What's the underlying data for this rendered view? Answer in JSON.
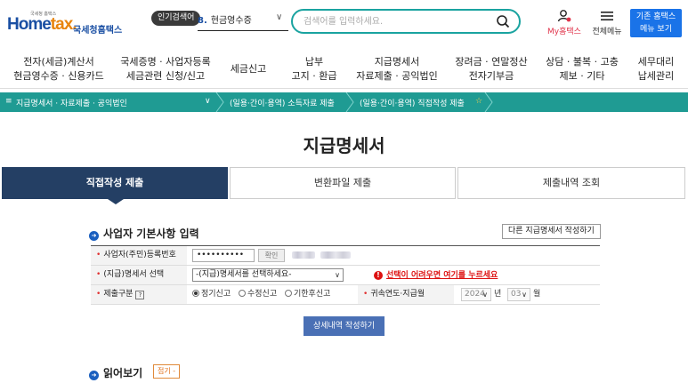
{
  "header": {
    "logo_tagline": "국세청 홈택스",
    "logo_home": "Home",
    "logo_tax": "tax.",
    "logo_text": "국세청홈택스",
    "popular_badge": "인기검색어",
    "popular_rank": "8.",
    "popular_term": "현금영수증",
    "search_placeholder": "검색어를 입력하세요.",
    "my_hometax": "My홈택스",
    "all_menu": "전체메뉴",
    "old_menu_line1": "기존 홈택스",
    "old_menu_line2": "메뉴 보기"
  },
  "nav": [
    {
      "l1": "전자(세금)계산서",
      "l2": "현금영수증 · 신용카드"
    },
    {
      "l1": "국세증명 · 사업자등록",
      "l2": "세금관련 신청/신고"
    },
    {
      "l1": "세금신고",
      "l2": ""
    },
    {
      "l1": "납부",
      "l2": "고지 · 환급"
    },
    {
      "l1": "지급명세서",
      "l2": "자료제출 · 공익법인"
    },
    {
      "l1": "장려금 · 연말정산",
      "l2": "전자기부금"
    },
    {
      "l1": "상담 · 불복 · 고충",
      "l2": "제보 · 기타"
    },
    {
      "l1": "세무대리",
      "l2": "납세관리"
    }
  ],
  "breadcrumb": {
    "c1": "지급명세서 · 자료제출 · 공익법인",
    "c2": "(일용·간이·용역) 소득자료 제출",
    "c3": "(일용·간이·용역) 직접작성 제출"
  },
  "page_title": "지급명세서",
  "tabs": [
    "직접작성 제출",
    "변환파일 제출",
    "제출내역 조회"
  ],
  "section1": {
    "title": "사업자 기본사항 입력",
    "other_button": "다른 지급명세서 작성하기",
    "rows": {
      "bizno_label": "사업자(주민)등록번호",
      "bizno_value": "••••••••••",
      "confirm_label": "확인",
      "type_label": "(지급)명세서 선택",
      "type_select": "-(지급)명세서를 선택하세요-",
      "warning": "선택이 어려우면 여기를 누르세요",
      "submit_label": "제출구분",
      "help_q": "?",
      "opt_regular": "정기신고",
      "opt_amend": "수정신고",
      "opt_late": "기한후신고",
      "year_label": "귀속연도·지급월",
      "year_value": "2024",
      "year_unit": "년",
      "month_value": "03",
      "month_unit": "월"
    },
    "detail_button": "상세내역 작성하기"
  },
  "section2": {
    "title": "읽어보기",
    "collapse_button": "접기 -"
  },
  "colors": {
    "teal": "#1f9b93",
    "navy_tab": "#243f64",
    "brand_blue": "#1a4fa3",
    "button_blue": "#4a70b5"
  }
}
